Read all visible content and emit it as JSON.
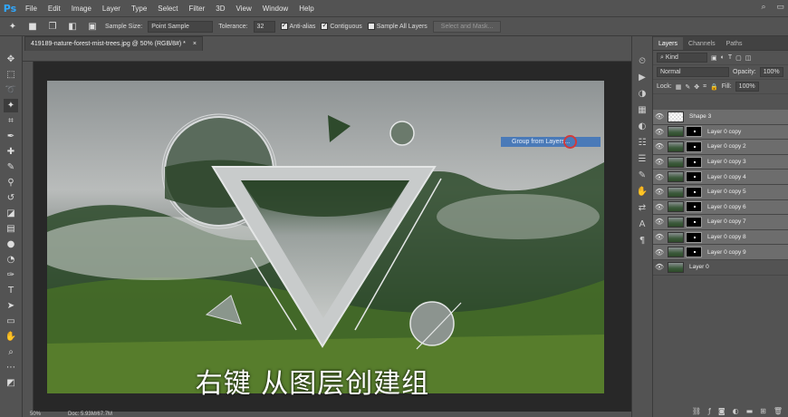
{
  "app": {
    "logo": "Ps"
  },
  "menu": [
    "File",
    "Edit",
    "Image",
    "Layer",
    "Type",
    "Select",
    "Filter",
    "3D",
    "View",
    "Window",
    "Help"
  ],
  "options": {
    "sample_size_label": "Sample Size:",
    "sample_size_value": "Point Sample",
    "tolerance_label": "Tolerance:",
    "tolerance_value": "32",
    "anti_alias": "Anti-alias",
    "contiguous": "Contiguous",
    "sample_all": "Sample All Layers",
    "select_mask": "Select and Mask..."
  },
  "document": {
    "tab_title": "419189-nature-forest-mist-trees.jpg @ 50% (RGB/8#) *",
    "close": "×"
  },
  "status": {
    "zoom": "50%",
    "doc": "Doc: 5.93M/67.7M"
  },
  "context_menu": {
    "item": "Group from Layers..."
  },
  "subtitle": "右键 从图层创建组",
  "panel": {
    "tabs": [
      "Layers",
      "Channels",
      "Paths"
    ],
    "kind": "Kind",
    "blend": "Normal",
    "opacity_label": "Opacity:",
    "opacity_value": "100%",
    "lock_label": "Lock:",
    "fill_label": "Fill:",
    "fill_value": "100%"
  },
  "layers": [
    {
      "name": "Shape 3"
    },
    {
      "name": "Layer 0 copy"
    },
    {
      "name": "Layer 0 copy 2"
    },
    {
      "name": "Layer 0 copy 3"
    },
    {
      "name": "Layer 0 copy 4"
    },
    {
      "name": "Layer 0 copy 5"
    },
    {
      "name": "Layer 0 copy 6"
    },
    {
      "name": "Layer 0 copy 7"
    },
    {
      "name": "Layer 0 copy 8"
    },
    {
      "name": "Layer 0 copy 9"
    },
    {
      "name": "Layer 0"
    }
  ],
  "colors": {
    "accent": "#31a8ff",
    "highlight": "#4a7ab8"
  }
}
